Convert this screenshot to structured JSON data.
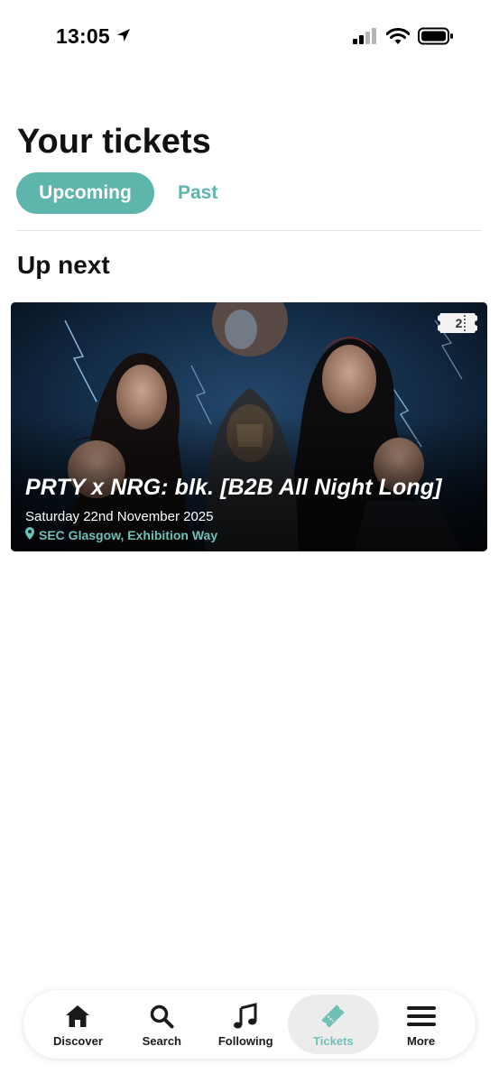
{
  "status_bar": {
    "time": "13:05",
    "icons": [
      "location-arrow-icon",
      "cellular-signal-icon",
      "wifi-icon",
      "battery-icon"
    ]
  },
  "header": {
    "title": "Your tickets",
    "tabs": [
      {
        "label": "Upcoming",
        "active": true
      },
      {
        "label": "Past",
        "active": false
      }
    ]
  },
  "section": {
    "title": "Up next"
  },
  "event": {
    "name": "PRTY x NRG: blk. [B2B All Night Long]",
    "date": "Saturday 22nd November 2025",
    "venue": "SEC Glasgow, Exhibition Way",
    "ticket_count": "2"
  },
  "tab_bar": {
    "items": [
      {
        "label": "Discover",
        "icon": "home-icon",
        "active": false
      },
      {
        "label": "Search",
        "icon": "search-icon",
        "active": false
      },
      {
        "label": "Following",
        "icon": "music-note-icon",
        "active": false
      },
      {
        "label": "Tickets",
        "icon": "ticket-icon",
        "active": true
      },
      {
        "label": "More",
        "icon": "menu-icon",
        "active": false
      }
    ]
  },
  "colors": {
    "accent": "#5eb5ac",
    "accent_text": "#6fc1b8",
    "tab_active_bg": "#ececec"
  }
}
